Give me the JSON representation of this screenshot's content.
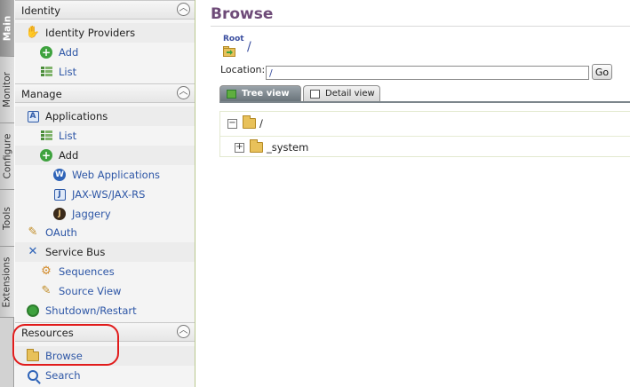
{
  "vtabs": [
    "Main",
    "Monitor",
    "Configure",
    "Tools",
    "Extensions"
  ],
  "sections": {
    "identity": {
      "title": "Identity",
      "items": [
        "Identity Providers",
        "Add",
        "List"
      ]
    },
    "manage": {
      "title": "Manage",
      "items": [
        "Applications",
        "List",
        "Add",
        "Web Applications",
        "JAX-WS/JAX-RS",
        "Jaggery",
        "OAuth",
        "Service Bus",
        "Sequences",
        "Source View",
        "Shutdown/Restart"
      ]
    },
    "resources": {
      "title": "Resources",
      "items": [
        "Browse",
        "Search"
      ]
    }
  },
  "collapse_glyph": "︿",
  "main": {
    "title": "Browse",
    "root_label": "Root",
    "root_path": "/",
    "location_label": "Location:",
    "location_value": "/",
    "go_label": "Go",
    "tabs": [
      "Tree view",
      "Detail view"
    ],
    "tree": {
      "root": "/",
      "child": "_system"
    },
    "collapse_symbol": "−",
    "expand_symbol": "+"
  },
  "highlight_color": "#e11b1b",
  "title_color": "#6e4b78",
  "link_color": "#2d56a6"
}
